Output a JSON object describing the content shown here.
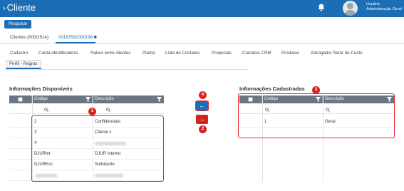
{
  "header": {
    "chevron": "›",
    "title": "Cliente",
    "bell_icon": "bell-icon",
    "user_label": "Usuário",
    "user_name": "Administração Geral"
  },
  "toolbar": {
    "search_label": "Pesquisar"
  },
  "doc_tabs": {
    "list_label": "Clientes (500/2514)",
    "record_label": "00167591000196",
    "close_glyph": "✖"
  },
  "sub_tabs": [
    "Cadastro",
    "Conta identificadora",
    "Rateio entre clientes",
    "Planta",
    "Lista de Contatos",
    "Propostas",
    "Contatos CRM",
    "Produtos",
    "Advogado/ Setor de Custo",
    "Perfil - Regras"
  ],
  "left_panel": {
    "title": "Informações Disponíveis",
    "col_code": "Código",
    "col_desc": "Descrição",
    "rows": [
      {
        "code": "2",
        "desc": "Confidenciais"
      },
      {
        "code": "3",
        "desc": "Cliente x"
      },
      {
        "code": "4",
        "desc": ""
      },
      {
        "code": "DJURInt",
        "desc": "DJUR Interno"
      },
      {
        "code": "DJUREsc",
        "desc": "Solicitante"
      },
      {
        "code": "",
        "desc": ""
      }
    ]
  },
  "right_panel": {
    "title": "Informações Cadastradas",
    "col_code": "Código",
    "col_desc": "Descrição",
    "rows": [
      {
        "code": "1",
        "desc": "Geral"
      }
    ]
  },
  "badges": {
    "b1": "1",
    "b2": "2",
    "b3": "3",
    "b4": "4"
  },
  "arrows": {
    "left": "←",
    "right": "→"
  },
  "colors": {
    "brand": "#1b6db5",
    "highlight": "#e8232b",
    "grid_header": "#6b7683"
  }
}
